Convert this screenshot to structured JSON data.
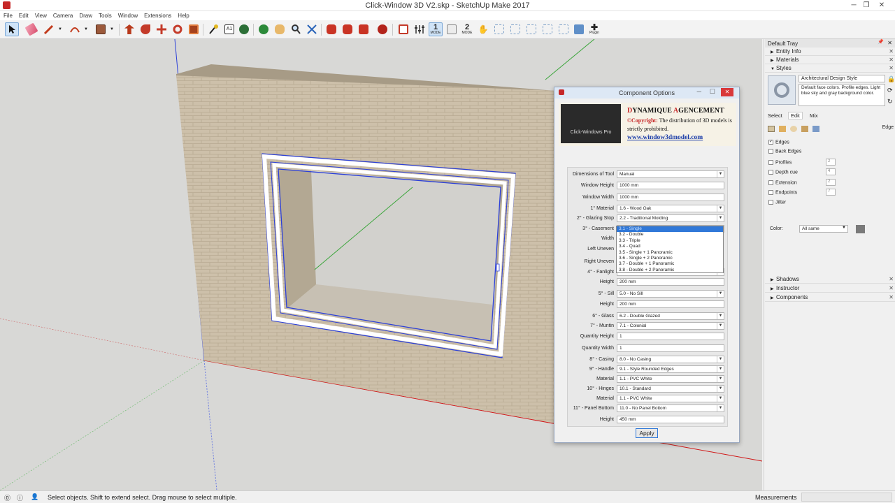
{
  "window": {
    "title": "Click-Window 3D V2.skp - SketchUp Make 2017"
  },
  "menu": [
    "File",
    "Edit",
    "View",
    "Camera",
    "Draw",
    "Tools",
    "Window",
    "Extensions",
    "Help"
  ],
  "toolbar": {
    "mode1_number": "1",
    "mode1_label": "MODE",
    "mode2_number": "2",
    "mode2_label": "MODE",
    "plugin_label": "Plugin"
  },
  "dialog": {
    "title": "Component Options",
    "brand_d": "D",
    "brand_ynamique": "YNAMIQUE ",
    "brand_a": "A",
    "brand_gencement": "GENCEMENT",
    "copyright_label": "©Copyright:",
    "copyright_text": " The distribution of 3D models is strictly prohibited.",
    "website": "www.window3dmodel.com",
    "logo_text": "Click-Windows Pro",
    "apply_label": "Apply",
    "fields": [
      {
        "label": "Dimensions of Tool",
        "value": "Manual",
        "dropdown": true
      },
      {
        "label": "Window Height",
        "value": "1000 mm",
        "dropdown": false
      },
      {
        "label": "Window Width",
        "value": "1000 mm",
        "dropdown": false
      },
      {
        "label": "1° Material",
        "value": "1.6 - Wood Oak",
        "dropdown": true
      },
      {
        "label": "2° - Glazing Stop",
        "value": "2.2 - Traditional Molding",
        "dropdown": true
      },
      {
        "label": "3° - Casement",
        "value": "3.1 - Single",
        "dropdown": true
      },
      {
        "label": "Width",
        "value": "",
        "dropdown": false
      },
      {
        "label": "Left Uneven",
        "value": "",
        "dropdown": false
      },
      {
        "label": "Right Uneven",
        "value": "",
        "dropdown": false
      },
      {
        "label": "4° - Fanlight",
        "value": "",
        "dropdown": true
      },
      {
        "label": "Height",
        "value": "200 mm",
        "dropdown": false
      },
      {
        "label": "5° - Sill",
        "value": "5.0 - No Sill",
        "dropdown": true
      },
      {
        "label": "Height",
        "value": "200 mm",
        "dropdown": false
      },
      {
        "label": "6° - Glass",
        "value": "6.2 - Double Glazed",
        "dropdown": true
      },
      {
        "label": "7° - Muntin",
        "value": "7.1 - Colonial",
        "dropdown": true
      },
      {
        "label": "Quantity Height",
        "value": "1",
        "dropdown": false
      },
      {
        "label": "Quantity Width",
        "value": "1",
        "dropdown": false
      },
      {
        "label": "8° - Casing",
        "value": "8.0 - No Casing",
        "dropdown": true
      },
      {
        "label": "9° - Handle",
        "value": "9.1 - Style Rounded Edges",
        "dropdown": true
      },
      {
        "label": "Material",
        "value": "1.1 - PVC White",
        "dropdown": true
      },
      {
        "label": "10° - Hinges",
        "value": "10.1 - Standard",
        "dropdown": true
      },
      {
        "label": "Material",
        "value": "1.1 - PVC White",
        "dropdown": true
      },
      {
        "label": "11° - Panel Bottom",
        "value": "11.0 - No Panel Bottom",
        "dropdown": true
      },
      {
        "label": "Height",
        "value": "450 mm",
        "dropdown": false
      }
    ],
    "casement_options": [
      "3.1 - Single",
      "3.2 - Double",
      "3.3 - Triple",
      "3.4 - Quad",
      "3.5 - Single + 1 Panoramic",
      "3.6 - Single + 2 Panoramic",
      "3.7 - Double + 1 Panoramic",
      "3.8 - Double + 2 Panoramic"
    ]
  },
  "tray": {
    "title": "Default Tray",
    "panels": [
      "Entity Info",
      "Materials",
      "Styles"
    ],
    "style_name": "Architectural Design Style",
    "style_desc": "Default face colors. Profile edges. Light blue sky and gray background color.",
    "tabs": [
      "Select",
      "Edit",
      "Mix"
    ],
    "edge_label": "Edge",
    "edge_options": [
      {
        "label": "Edges",
        "checked": true,
        "value": ""
      },
      {
        "label": "Back Edges",
        "checked": false,
        "value": ""
      },
      {
        "label": "Profiles",
        "checked": false,
        "value": "2"
      },
      {
        "label": "Depth cue",
        "checked": false,
        "value": "4"
      },
      {
        "label": "Extension",
        "checked": false,
        "value": "2"
      },
      {
        "label": "Endpoints",
        "checked": false,
        "value": "7"
      },
      {
        "label": "Jitter",
        "checked": false,
        "value": ""
      }
    ],
    "color_label": "Color:",
    "color_value": "All same",
    "collapsed_panels": [
      "Shadows",
      "Instructor",
      "Components"
    ]
  },
  "status": {
    "hint": "Select objects. Shift to extend select. Drag mouse to select multiple.",
    "measurements_label": "Measurements"
  },
  "colors": {
    "selection_blue": "#2b3fd8",
    "axis_red": "#d01818",
    "axis_green": "#3aa53a",
    "wall": "#cfc2ad",
    "sky": "#d8d8d6",
    "dialog_close": "#d9383a"
  }
}
